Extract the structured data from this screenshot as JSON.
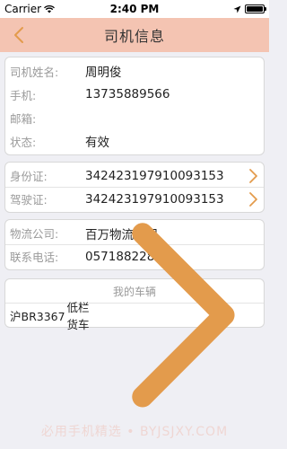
{
  "status_bar": {
    "carrier": "Carrier",
    "time": "2:40 PM",
    "battery_level": 1.0
  },
  "nav": {
    "title": "司机信息",
    "back_icon": "chevron-left-icon"
  },
  "driver": {
    "name_label": "司机姓名:",
    "name_value": "周明俊",
    "phone_label": "手机:",
    "phone_value": "13735889566",
    "email_label": "邮箱:",
    "email_value": "",
    "status_label": "状态:",
    "status_value": "有效"
  },
  "documents": {
    "id_card_label": "身份证:",
    "id_card_value": "342423197910093153",
    "license_label": "驾驶证:",
    "license_value": "342423197910093153"
  },
  "company": {
    "company_label": "物流公司:",
    "company_value": "百万物流公司",
    "contact_label": "联系电话:",
    "contact_value": "057188228130"
  },
  "vehicles": {
    "header": "我的车辆",
    "items": [
      {
        "plate": "沪BR3367",
        "type": "低栏货车"
      }
    ]
  },
  "watermark": "必用手机精选 • BYJSJXY.COM",
  "colors": {
    "nav_bg": "#f4c4b2",
    "accent": "#e39b4c",
    "page_bg": "#efeff4"
  }
}
